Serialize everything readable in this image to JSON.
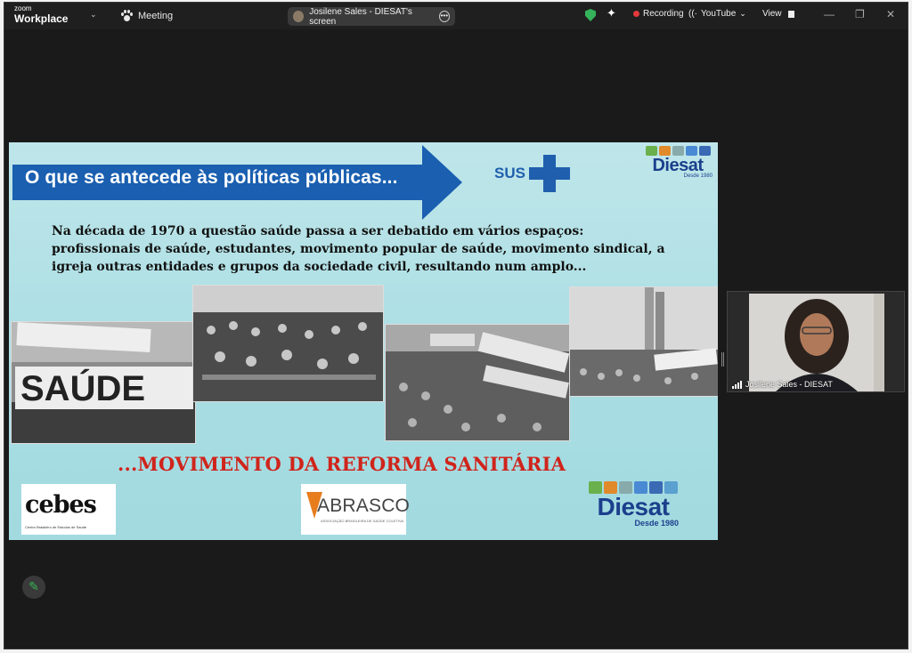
{
  "app": {
    "brand_small": "zoom",
    "brand_name": "Workplace"
  },
  "titlebar": {
    "meeting_label": "Meeting",
    "share_label": "Josilene Sales - DIESAT's screen",
    "recording_label": "Recording",
    "youtube_label": "YouTube",
    "view_label": "View"
  },
  "slide": {
    "title": "O que se antecede às políticas  públicas...",
    "sus_label": "SUS",
    "diesat_name": "Diesat",
    "diesat_since": "Desde 1980",
    "paragraph": "Na década de 1970 a questão saúde passa a ser debatido em vários espaços: profissionais de saúde, estudantes, movimento popular de saúde, movimento sindical, a igreja outras entidades e grupos da sociedade civil, resultando num amplo...",
    "photo_banner_text": "SAÚDE",
    "movement_title": "...MOVIMENTO DA REFORMA SANITÁRIA",
    "logos": {
      "cebes_name": "cebes",
      "cebes_sub": "Centro Brasileiro de Estudos de Saúde",
      "abrasco_name": "ABRASCO",
      "abrasco_sub": "ASSOCIAÇÃO BRASILEIRA DE SAÚDE COLETIVA"
    }
  },
  "participant": {
    "name": "Josilene Sales - DIESAT"
  },
  "colors": {
    "slide_arrow": "#1a5fb0",
    "movement_red": "#d0241b",
    "diesat_blue": "#1b3f8c",
    "shield_green": "#35b35a",
    "recording_red": "#e5383b"
  }
}
